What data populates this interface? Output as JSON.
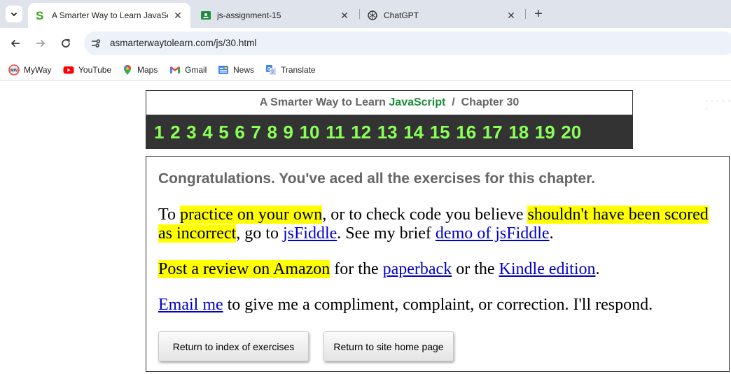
{
  "browser": {
    "tabs": [
      {
        "title": "A Smarter Way to Learn JavaScript",
        "icon": "smarter-way-favicon",
        "active": true
      },
      {
        "title": "js-assignment-15",
        "icon": "google-classroom-icon",
        "active": false
      },
      {
        "title": "ChatGPT",
        "icon": "chatgpt-icon",
        "active": false
      }
    ],
    "close_glyph": "✕",
    "new_tab_glyph": "+",
    "url": "asmarterwaytolearn.com/js/30.html",
    "bookmarks": [
      {
        "label": "MyWay",
        "icon": "myway-icon"
      },
      {
        "label": "YouTube",
        "icon": "youtube-icon"
      },
      {
        "label": "Maps",
        "icon": "maps-icon"
      },
      {
        "label": "Gmail",
        "icon": "gmail-icon"
      },
      {
        "label": "News",
        "icon": "news-icon"
      },
      {
        "label": "Translate",
        "icon": "translate-icon"
      }
    ]
  },
  "header": {
    "prefix": "A Smarter Way to Learn",
    "brand": "JavaScript",
    "separator": "/",
    "chapter": "Chapter 30"
  },
  "chapter_numbers": [
    "1",
    "2",
    "3",
    "4",
    "5",
    "6",
    "7",
    "8",
    "9",
    "10",
    "11",
    "12",
    "13",
    "14",
    "15",
    "16",
    "17",
    "18",
    "19",
    "20"
  ],
  "content": {
    "congrats": "Congratulations. You've aced all the exercises for this chapter.",
    "p1": {
      "t1": "To ",
      "hl1": "practice on your own",
      "t2": ", or to check code you believe ",
      "hl2": "shouldn't have been scored as incorrect",
      "t3": ", go to ",
      "link1": "jsFiddle",
      "t4": ". See my brief ",
      "link2": "demo of jsFiddle",
      "t5": "."
    },
    "p2": {
      "hl": "Post a review on Amazon",
      "t1": " for the ",
      "link1": "paperback",
      "t2": " or the ",
      "link2": "Kindle edition",
      "t3": "."
    },
    "p3": {
      "link": "Email me",
      "t1": " to give me a compliment, complaint, or correction. I'll respond."
    },
    "buttons": {
      "index": "Return to index of exercises",
      "home": "Return to site home page"
    }
  },
  "side_dots": "· · · · · ·",
  "colors": {
    "brand_green": "#1a8c3a",
    "chapter_bar_bg": "#333333",
    "chapter_number": "#8aff5a",
    "highlight": "#ffff00",
    "link": "#0000cc"
  }
}
